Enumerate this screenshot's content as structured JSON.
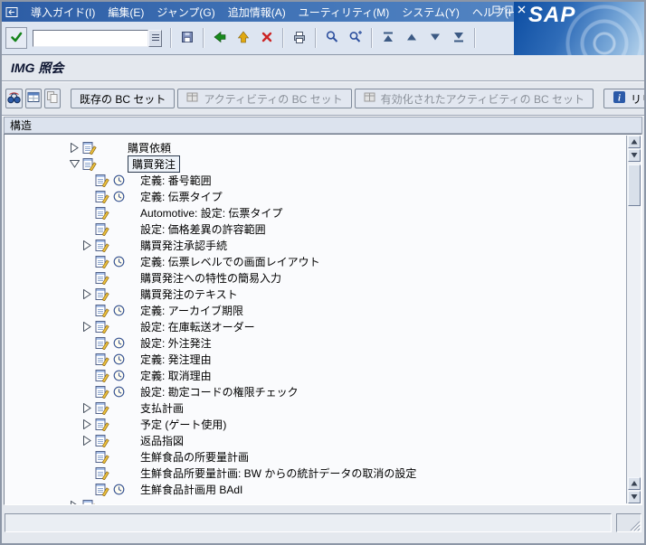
{
  "window": {
    "logo_text": "SAP",
    "controls": [
      "minimize",
      "maximize",
      "close"
    ]
  },
  "menubar": {
    "items": [
      "導入ガイド(I)",
      "編集(E)",
      "ジャンプ(G)",
      "追加情報(A)",
      "ユーティリティ(M)",
      "システム(Y)",
      "ヘルプ(H)"
    ]
  },
  "toolbar": {
    "command_field": {
      "value": ""
    },
    "button_icons": [
      "enter-check",
      "command-history",
      "save-floppy",
      "back-green-arrow",
      "exit-yellow-arrow",
      "cancel-red-x",
      "print",
      "find-magnifier",
      "find-next-magnifier-plus",
      "first-page",
      "page-up",
      "page-down",
      "last-page",
      "new-session-windows",
      "generate-shortcut",
      "help-question"
    ]
  },
  "page": {
    "title": "IMG 照会"
  },
  "app_toolbar": {
    "icon_buttons": [
      "find-binoculars",
      "display-structure",
      "copy-disabled",
      "position-page-arrow"
    ],
    "text_buttons": [
      {
        "label": "既存の BC セット",
        "enabled": true
      },
      {
        "label": "アクティビティの BC セット",
        "enabled": false
      },
      {
        "label": "有効化されたアクティビティの BC セット",
        "enabled": false
      },
      {
        "label": "リリースノート",
        "enabled": true
      }
    ]
  },
  "tree": {
    "header": "構造",
    "rows": [
      {
        "level": 1,
        "expander": "collapsed",
        "clock": false,
        "selected": false,
        "label": "購買依頼"
      },
      {
        "level": 1,
        "expander": "expanded",
        "clock": false,
        "selected": true,
        "label": "購買発注"
      },
      {
        "level": 2,
        "expander": "none",
        "clock": true,
        "selected": false,
        "label": "定義: 番号範囲"
      },
      {
        "level": 2,
        "expander": "none",
        "clock": true,
        "selected": false,
        "label": "定義: 伝票タイプ"
      },
      {
        "level": 2,
        "expander": "none",
        "clock": false,
        "selected": false,
        "label": "Automotive: 設定: 伝票タイプ"
      },
      {
        "level": 2,
        "expander": "none",
        "clock": false,
        "selected": false,
        "label": "設定: 価格差異の許容範囲"
      },
      {
        "level": 2,
        "expander": "collapsed",
        "clock": false,
        "selected": false,
        "label": "購買発注承認手続"
      },
      {
        "level": 2,
        "expander": "none",
        "clock": true,
        "selected": false,
        "label": "定義: 伝票レベルでの画面レイアウト"
      },
      {
        "level": 2,
        "expander": "none",
        "clock": false,
        "selected": false,
        "label": "購買発注への特性の簡易入力"
      },
      {
        "level": 2,
        "expander": "collapsed",
        "clock": false,
        "selected": false,
        "label": "購買発注のテキスト"
      },
      {
        "level": 2,
        "expander": "none",
        "clock": true,
        "selected": false,
        "label": "定義: アーカイブ期限"
      },
      {
        "level": 2,
        "expander": "collapsed",
        "clock": false,
        "selected": false,
        "label": "設定: 在庫転送オーダー"
      },
      {
        "level": 2,
        "expander": "none",
        "clock": true,
        "selected": false,
        "label": "設定: 外注発注"
      },
      {
        "level": 2,
        "expander": "none",
        "clock": true,
        "selected": false,
        "label": "定義: 発注理由"
      },
      {
        "level": 2,
        "expander": "none",
        "clock": true,
        "selected": false,
        "label": "定義: 取消理由"
      },
      {
        "level": 2,
        "expander": "none",
        "clock": true,
        "selected": false,
        "label": "設定: 勘定コードの権限チェック"
      },
      {
        "level": 2,
        "expander": "collapsed",
        "clock": false,
        "selected": false,
        "label": "支払計画"
      },
      {
        "level": 2,
        "expander": "collapsed",
        "clock": false,
        "selected": false,
        "label": "予定 (ゲート使用)"
      },
      {
        "level": 2,
        "expander": "collapsed",
        "clock": false,
        "selected": false,
        "label": "返品指図"
      },
      {
        "level": 2,
        "expander": "none",
        "clock": false,
        "selected": false,
        "label": "生鮮食品の所要量計画"
      },
      {
        "level": 2,
        "expander": "none",
        "clock": false,
        "selected": false,
        "label": "生鮮食品所要量計画: BW からの統計データの取消の設定"
      },
      {
        "level": 2,
        "expander": "none",
        "clock": true,
        "selected": false,
        "label": "生鮮食品計画用 BAdI"
      },
      {
        "level": 1,
        "expander": "collapsed",
        "clock": false,
        "selected": false,
        "label": "",
        "partial": true
      }
    ]
  },
  "status_bar": {
    "message": ""
  }
}
